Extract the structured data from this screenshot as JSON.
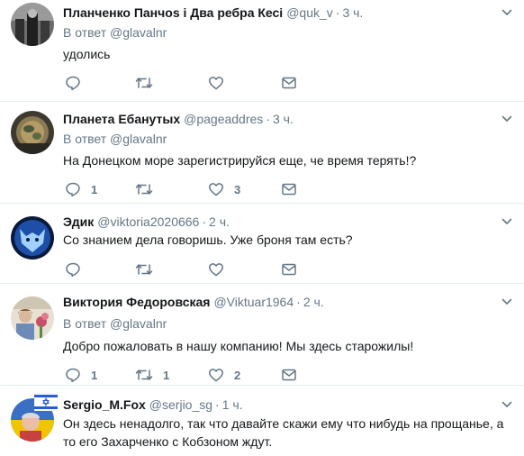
{
  "replying_label": "В ответ",
  "tweets": [
    {
      "name": "Планченко Панчоs і Два ребра Кесі",
      "handle": "@quk_v",
      "time": "3 ч.",
      "reply_to": "@glavalnr",
      "text": "удолись",
      "reply_count": "",
      "retweet_count": "",
      "like_count": ""
    },
    {
      "name": "Планета Ебанутых",
      "handle": "@pageaddres",
      "time": "3 ч.",
      "reply_to": "@glavalnr",
      "text": "На Донецком море зарегистрируйся еще, че время терять!?",
      "reply_count": "1",
      "retweet_count": "",
      "like_count": "3"
    },
    {
      "name": "Эдик",
      "handle": "@viktoria2020666",
      "time": "2 ч.",
      "reply_to": "",
      "text": "Со знанием дела говоришь. Уже броня там есть?",
      "reply_count": "",
      "retweet_count": "",
      "like_count": ""
    },
    {
      "name": "Виктория Федоровская",
      "handle": "@Viktuar1964",
      "time": "2 ч.",
      "reply_to": "@glavalnr",
      "text": "Добро пожаловать в нашу компанию! Мы здесь старожилы!",
      "reply_count": "1",
      "retweet_count": "1",
      "like_count": "2"
    },
    {
      "name": "Sergio_M.Fox",
      "handle": "@serjio_sg",
      "time": "1 ч.",
      "reply_to": "",
      "text": "Он здесь ненадолго, так что давайте скажи ему что нибудь на прощанье, а то его Захарченко с Кобзоном ждут.",
      "reply_count": "",
      "retweet_count": "",
      "like_count": ""
    }
  ],
  "colors": {
    "text": "#14171a",
    "secondary": "#657786",
    "divider": "#e6ecf0"
  },
  "icons": [
    "reply-icon",
    "retweet-icon",
    "like-icon",
    "direct-message-icon",
    "chevron-down-icon",
    "israel-flag-icon"
  ]
}
